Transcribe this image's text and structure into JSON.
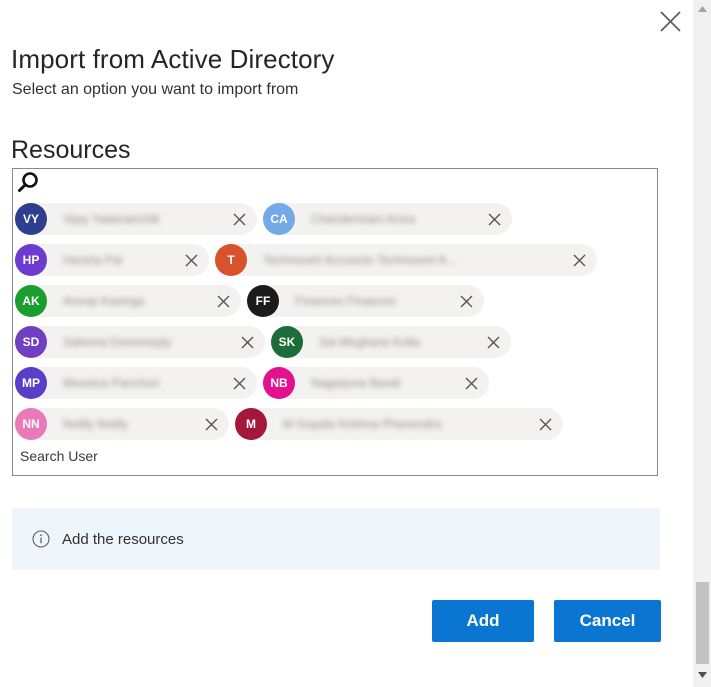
{
  "dialog": {
    "title": "Import from Active Directory",
    "subtitle": "Select an option you want to import from",
    "section_label": "Resources",
    "search_placeholder": "Search User",
    "info_text": "Add the resources",
    "add_label": "Add",
    "cancel_label": "Cancel"
  },
  "chips": [
    [
      {
        "initials": "VY",
        "color": "#2e3f8f",
        "name": "Vijay Yalamanchili"
      },
      {
        "initials": "CA",
        "color": "#72a9e6",
        "name": "Chandermani Arora"
      }
    ],
    [
      {
        "initials": "HP",
        "color": "#6c3bd0",
        "name": "Harsha Pai"
      },
      {
        "initials": "T",
        "color": "#d9522c",
        "name": "Technovert Accounts Technovert A..."
      }
    ],
    [
      {
        "initials": "AK",
        "color": "#1a9e2e",
        "name": "Anoop Kasinga"
      },
      {
        "initials": "FF",
        "color": "#1b1b1b",
        "name": "Finances Finances"
      }
    ],
    [
      {
        "initials": "SD",
        "color": "#7140c2",
        "name": "Saleena Donomeply"
      },
      {
        "initials": "SK",
        "color": "#1d6d3a",
        "name": "Sai Meghana Kolla"
      }
    ],
    [
      {
        "initials": "MP",
        "color": "#5a3ec8",
        "name": "Mounica Panchuri"
      },
      {
        "initials": "NB",
        "color": "#e3118f",
        "name": "Nagarjuna Bandi"
      }
    ],
    [
      {
        "initials": "NN",
        "color": "#e87ab9",
        "name": "Notify Notify"
      },
      {
        "initials": "M",
        "color": "#a3173a",
        "name": "M Gopala Krishna Phanendra"
      }
    ]
  ],
  "icons": {
    "close": "close-icon",
    "search": "search-icon",
    "info": "info-icon",
    "remove": "remove-icon"
  },
  "colors": {
    "primary_button": "#0b76d2",
    "info_background": "#eef5fb",
    "chip_background": "#f3f2f1"
  }
}
